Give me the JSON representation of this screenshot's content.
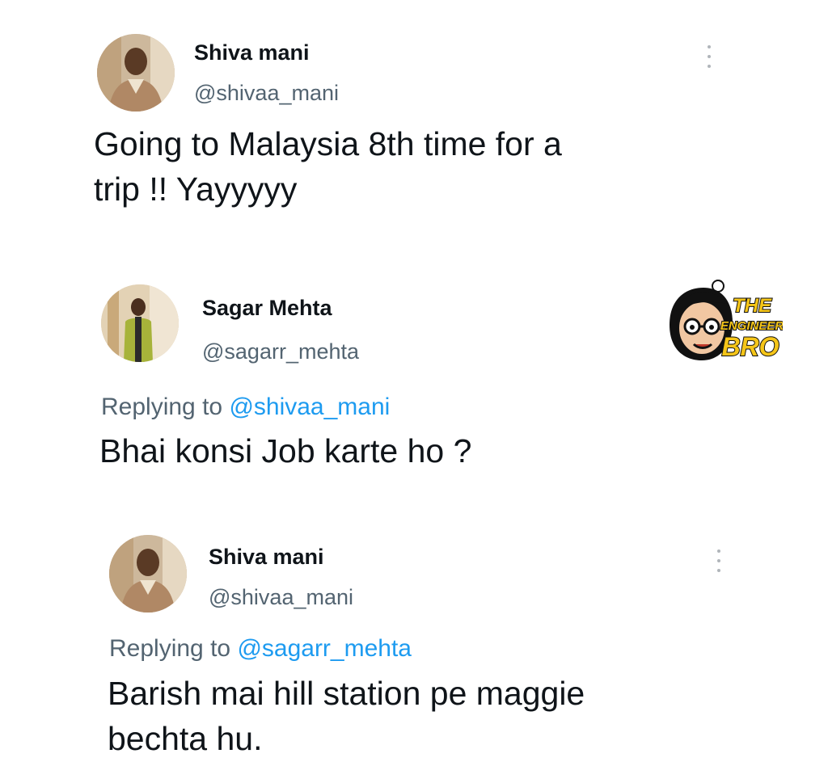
{
  "tweets": [
    {
      "name": "Shiva mani",
      "handle": "@shivaa_mani",
      "text_lines": [
        "Going to Malaysia 8th time for a",
        "trip !! Yayyyyy"
      ]
    },
    {
      "name": "Sagar Mehta",
      "handle": "@sagarr_mehta",
      "reply_prefix": "Replying to",
      "reply_to": "@shivaa_mani",
      "text_lines": [
        "Bhai konsi Job karte ho ?"
      ]
    },
    {
      "name": "Shiva mani",
      "handle": "@shivaa_mani",
      "reply_prefix": "Replying to",
      "reply_to": "@sagarr_mehta",
      "text_lines": [
        "Barish mai hill station pe maggie",
        "bechta hu."
      ]
    }
  ],
  "watermark": {
    "line1": "THE",
    "line2": "ENGINEER",
    "line3": "BRO"
  },
  "colors": {
    "handle": "#536471",
    "mention": "#1d9bf0",
    "text": "#0f1419",
    "logo_yellow": "#f5c518"
  },
  "icons": {
    "more": "more-vertical-icon"
  }
}
